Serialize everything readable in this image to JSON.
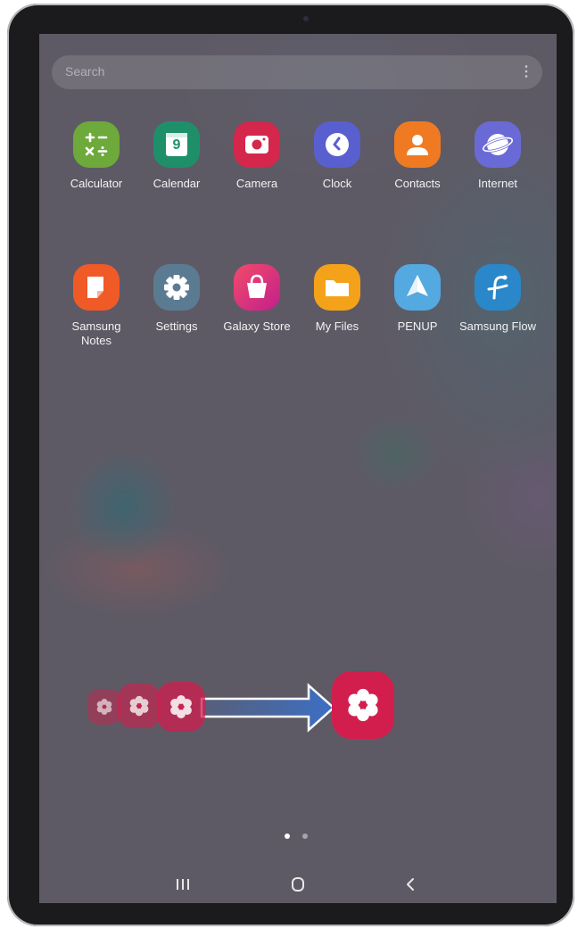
{
  "search": {
    "placeholder": "Search",
    "more": "⋮"
  },
  "apps_row1": [
    {
      "label": "Calculator",
      "icon": "calculator-icon",
      "color": "#6ea93c"
    },
    {
      "label": "Calendar",
      "icon": "calendar-icon",
      "color": "#1f8f6a"
    },
    {
      "label": "Camera",
      "icon": "camera-icon",
      "color": "#d5264b"
    },
    {
      "label": "Clock",
      "icon": "clock-icon",
      "color": "#5a5fd0"
    },
    {
      "label": "Contacts",
      "icon": "contacts-icon",
      "color": "#f07a22"
    },
    {
      "label": "Internet",
      "icon": "internet-icon",
      "color": "#6a6ad6"
    }
  ],
  "apps_row2": [
    {
      "label": "Samsung\nNotes",
      "icon": "samsung-notes-icon",
      "color": "#f05a27"
    },
    {
      "label": "Settings",
      "icon": "settings-icon",
      "color": "#5b7b92"
    },
    {
      "label": "Galaxy Store",
      "icon": "galaxy-store-icon",
      "color": "#d12f7b"
    },
    {
      "label": "My Files",
      "icon": "my-files-icon",
      "color": "#f5a21b"
    },
    {
      "label": "PENUP",
      "icon": "penup-icon",
      "color": "#53a9e0"
    },
    {
      "label": "Samsung Flow",
      "icon": "samsung-flow-icon",
      "color": "#2a87c9"
    }
  ],
  "calendar_day": "9",
  "gesture": {
    "accent": "#d21e4d",
    "arrow": "#3d6fc4"
  },
  "page_indicator": {
    "active": 0,
    "count": 2
  }
}
